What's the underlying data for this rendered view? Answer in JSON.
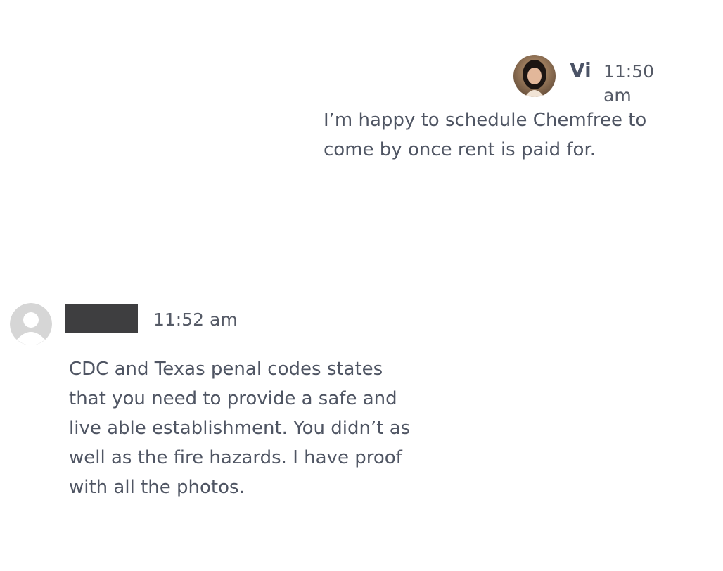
{
  "messages": [
    {
      "sender": "Vi",
      "time": "11:50 am",
      "text": "I’m happy to schedule Chemfree to\ncome by once rent is paid for.",
      "avatar_icon": "user-photo-avatar"
    },
    {
      "sender": "",
      "time": "11:52 am",
      "text": "CDC and Texas penal codes states\nthat you need to provide a safe and\nlive able establishment. You didn’t as\nwell as the fire hazards. I have proof\nwith all the photos.",
      "avatar_icon": "default-user-avatar-icon"
    }
  ]
}
